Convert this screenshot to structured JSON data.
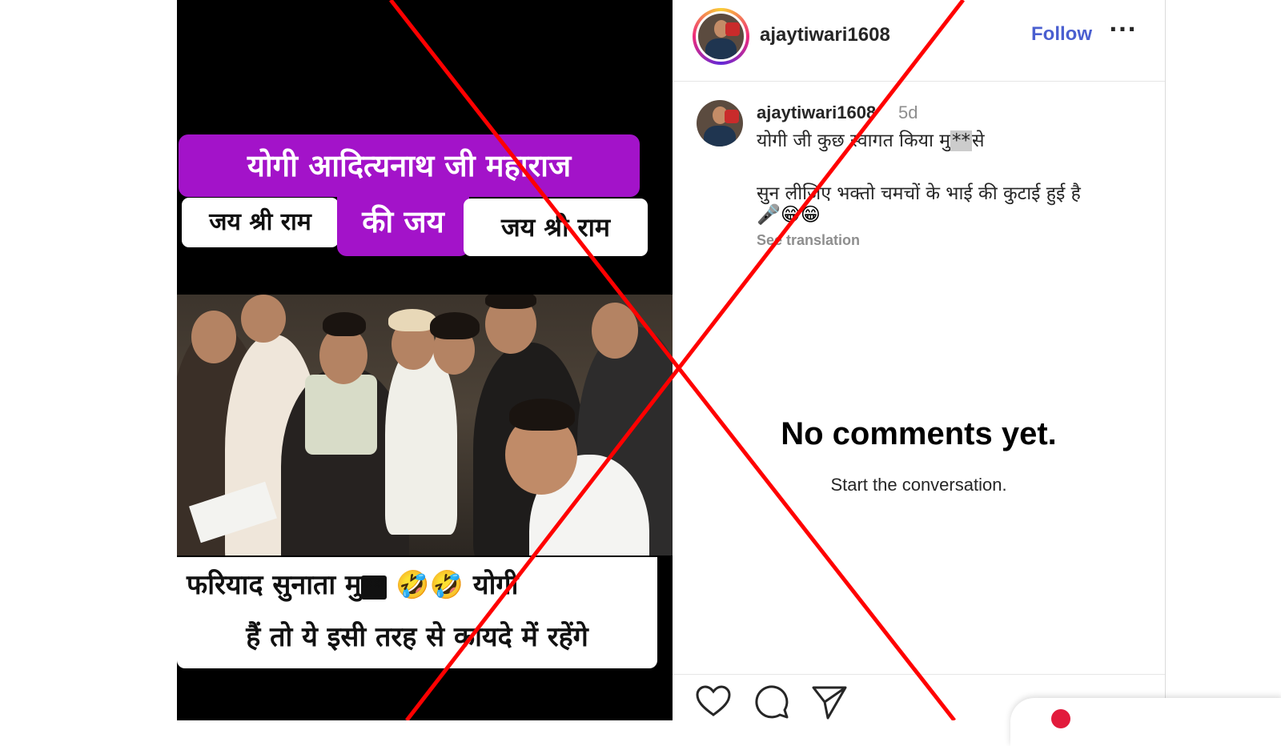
{
  "post": {
    "overlay_title": "योगी आदित्यनाथ जी महाराज",
    "overlay_left": "जय श्री राम",
    "overlay_mid": "की जय",
    "overlay_right": "जय श्री राम",
    "bottom_line1_a": "फरियाद सुनाता मु",
    "bottom_line1_mask": "**",
    "bottom_line1_b": "🤣🤣 योगी",
    "bottom_line2": "हैं तो ये इसी तरह से कायदे में रहेंगे"
  },
  "header": {
    "username": "ajaytiwari1608",
    "follow_label": "Follow",
    "more_label": "···"
  },
  "comment": {
    "username": "ajaytiwari1608",
    "time": "5d",
    "line1_a": "योगी जी कुछ स्वागत किया मु",
    "line1_mask": "**",
    "line1_b": "से",
    "line2": "सुन लीजिए भक्तो चमचों के भाई की कुटाई हुई है",
    "emojis": "🎤😁😁",
    "see_translation": "See translation"
  },
  "empty_state": {
    "title": "No comments yet.",
    "subtitle": "Start the conversation."
  },
  "actions": {
    "icons": [
      "heart-icon",
      "comment-icon",
      "share-icon"
    ]
  },
  "colors": {
    "banner_purple": "#a313c9",
    "follow_blue": "#4a5fd0",
    "cross_red": "#ff0000"
  }
}
